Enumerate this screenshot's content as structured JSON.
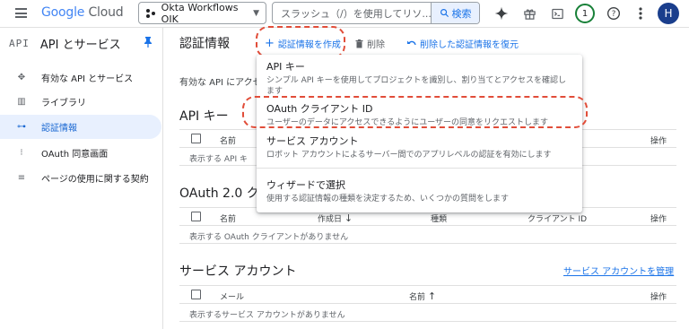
{
  "topbar": {
    "logo_google": "Google",
    "logo_cloud": "Cloud",
    "project": "Okta Workflows OIK",
    "search_placeholder": "スラッシュ（/）を使用してリソ...",
    "search_button": "検索",
    "notification_count": "1",
    "avatar_letter": "H"
  },
  "sidebar": {
    "icon_text": "API",
    "title": "API とサービス",
    "items": [
      {
        "label": "有効な API とサービス",
        "icon": "hub-icon"
      },
      {
        "label": "ライブラリ",
        "icon": "library-icon"
      },
      {
        "label": "認証情報",
        "icon": "key-icon",
        "active": true
      },
      {
        "label": "OAuth 同意画面",
        "icon": "consent-icon"
      },
      {
        "label": "ページの使用に関する契約",
        "icon": "settings-list-icon"
      }
    ]
  },
  "main": {
    "title": "認証情報",
    "create_button": "認証情報を作成",
    "delete_button": "削除",
    "restore_button": "削除した認証情報を復元",
    "description": "有効な API にアクセ",
    "api_keys": {
      "heading": "API キー",
      "col_name": "名前",
      "col_action": "操作",
      "empty": "表示する API キ"
    },
    "oauth": {
      "heading": "OAuth 2.0 クラ",
      "col_name": "名前",
      "col_created": "作成日",
      "col_type": "種類",
      "col_client_id": "クライアント ID",
      "col_action": "操作",
      "empty": "表示する OAuth クライアントがありません"
    },
    "service_accounts": {
      "heading": "サービス アカウント",
      "manage_link": "サービス アカウントを管理",
      "col_email": "メール",
      "col_name": "名前",
      "col_action": "操作",
      "empty": "表示するサービス アカウントがありません"
    }
  },
  "dropdown": {
    "items": [
      {
        "title": "API キー",
        "desc": "シンプル API キーを使用してプロジェクトを識別し、割り当てとアクセスを確認します"
      },
      {
        "title": "OAuth クライアント ID",
        "desc": "ユーザーのデータにアクセスできるようにユーザーの同意をリクエストします"
      },
      {
        "title": "サービス アカウント",
        "desc": "ロボット アカウントによるサーバー間でのアプリレベルの認証を有効にします"
      },
      {
        "title": "ウィザードで選択",
        "desc": "使用する認証情報の種類を決定するため、いくつかの質問をします"
      }
    ]
  },
  "colors": {
    "accent": "#1a73e8",
    "highlight": "#e14d39",
    "active_bg": "#e8f0fe"
  }
}
